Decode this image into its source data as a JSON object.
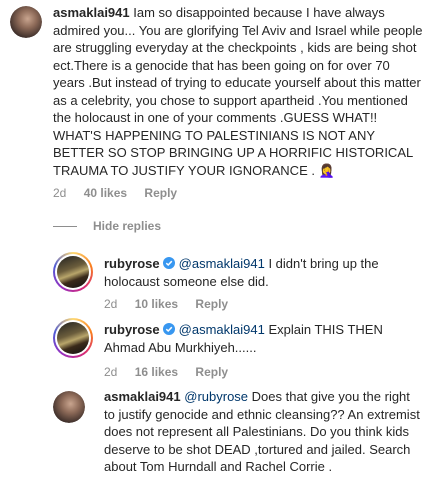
{
  "comments": [
    {
      "username": "asmaklai941",
      "verified": false,
      "text": "Iam so disappointed because I have always admired you... You are glorifying Tel Aviv and Israel while people are struggling everyday at the checkpoints , kids are being shot ect.There is a genocide that has been going on for over 70 years .But instead of trying to educate yourself about this matter as a celebrity, you chose to support apartheid .You mentioned the holocaust in one of your comments .GUESS WHAT!! WHAT'S HAPPENING TO PALESTINIANS IS NOT ANY BETTER SO STOP BRINGING UP A HORRIFIC HISTORICAL TRAUMA TO JUSTIFY YOUR IGNORANCE . 🤦‍♀️",
      "time": "2d",
      "likes": "40 likes",
      "reply": "Reply"
    },
    {
      "username": "rubyrose",
      "verified": true,
      "mention": "@asmaklai941",
      "text": " I didn't bring up the holocaust someone else did.",
      "time": "2d",
      "likes": "10 likes",
      "reply": "Reply"
    },
    {
      "username": "rubyrose",
      "verified": true,
      "mention": "@asmaklai941",
      "text": " Explain THIS THEN Ahmad Abu Murkhiyeh......",
      "time": "2d",
      "likes": "16 likes",
      "reply": "Reply"
    },
    {
      "username": "asmaklai941",
      "verified": false,
      "mention": "@rubyrose",
      "text": " Does that give you the right to justify genocide and ethnic cleansing?? An extremist does not represent all Palestinians. Do you think kids deserve to be shot DEAD ,tortured and jailed. Search about Tom Hurndall and Rachel Corrie ."
    }
  ],
  "hide_replies": "Hide replies",
  "colors": {
    "verified": "#3897f0",
    "mention": "#00376b",
    "meta": "#8e8e8e"
  }
}
